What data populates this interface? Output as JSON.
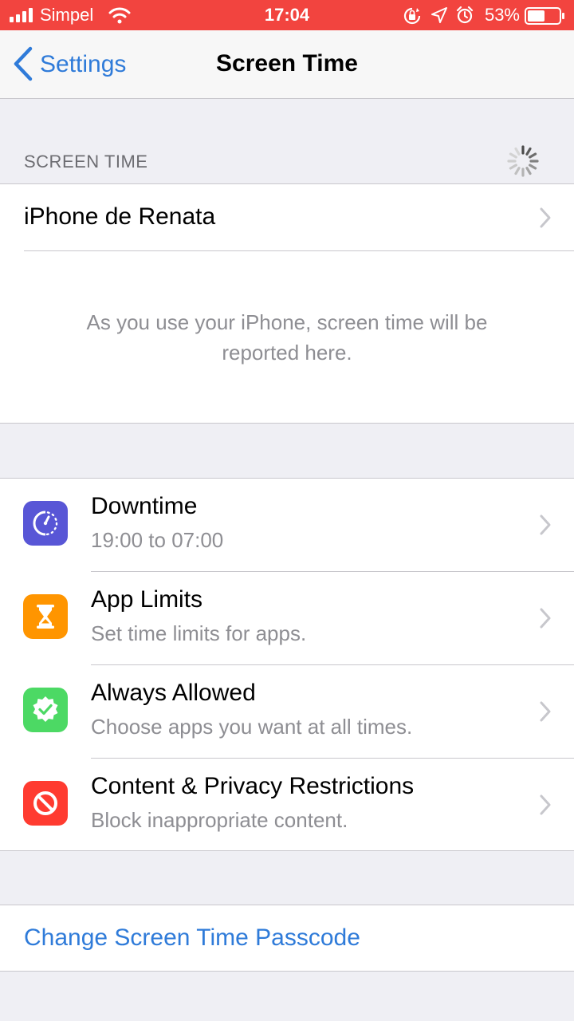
{
  "status_bar": {
    "carrier": "Simpel",
    "time": "17:04",
    "battery_percent": "53%",
    "color": "#f2443f"
  },
  "nav": {
    "back_label": "Settings",
    "title": "Screen Time"
  },
  "screen_time_section": {
    "header": "SCREEN TIME",
    "device_name": "iPhone de Renata",
    "note": "As you use your iPhone, screen time will be reported here."
  },
  "features": [
    {
      "title": "Downtime",
      "subtitle": "19:00 to 07:00",
      "icon": "downtime-icon",
      "color": "#5856d6"
    },
    {
      "title": "App Limits",
      "subtitle": "Set time limits for apps.",
      "icon": "hourglass-icon",
      "color": "#ff9500"
    },
    {
      "title": "Always Allowed",
      "subtitle": "Choose apps you want at all times.",
      "icon": "checkmark-badge-icon",
      "color": "#4cd964"
    },
    {
      "title": "Content & Privacy Restrictions",
      "subtitle": "Block inappropriate content.",
      "icon": "prohibited-icon",
      "color": "#ff3b30"
    }
  ],
  "passcode": {
    "label": "Change Screen Time Passcode"
  },
  "colors": {
    "link": "#2f7bd9",
    "background": "#efeff4"
  }
}
